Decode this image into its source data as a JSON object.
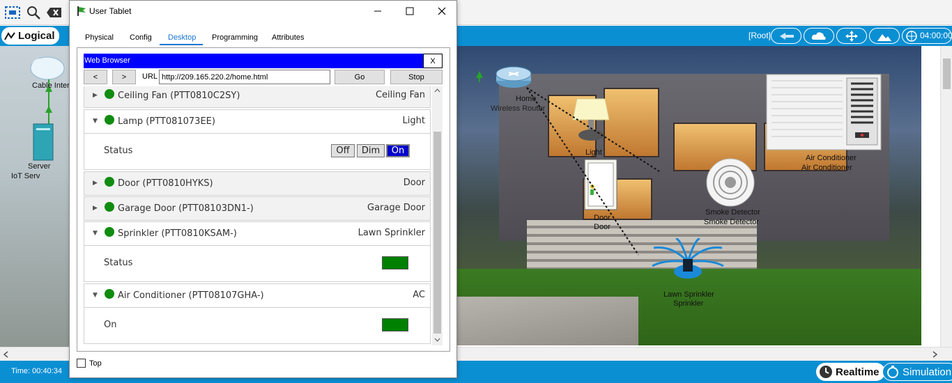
{
  "window": {
    "title": "User Tablet"
  },
  "tabs": [
    "Physical",
    "Config",
    "Desktop",
    "Programming",
    "Attributes"
  ],
  "active_tab": "Desktop",
  "browser": {
    "title": "Web Browser",
    "close_label": "X",
    "back_label": "<",
    "forward_label": ">",
    "url_label": "URL",
    "url_value": "http://209.165.220.2/home.html",
    "go_label": "Go",
    "stop_label": "Stop"
  },
  "devices": [
    {
      "name": "Ceiling Fan (PTT0810C2SY)",
      "type": "Ceiling Fan",
      "expanded": false
    },
    {
      "name": "Lamp (PTT081073EE)",
      "type": "Light",
      "expanded": true,
      "body_label": "Status",
      "buttons": [
        "Off",
        "Dim",
        "On"
      ],
      "active_button": "On"
    },
    {
      "name": "Door (PTT0810HYKS)",
      "type": "Door",
      "expanded": false
    },
    {
      "name": "Garage Door (PTT08103DN1-)",
      "type": "Garage Door",
      "expanded": false
    },
    {
      "name": "Sprinkler (PTT0810KSAM-)",
      "type": "Lawn Sprinkler",
      "expanded": true,
      "body_label": "Status",
      "indicator_color": "#008000"
    },
    {
      "name": "Air Conditioner (PTT08107GHA-)",
      "type": "AC",
      "expanded": true,
      "body_label": "On",
      "indicator_color": "#008000"
    }
  ],
  "top_checkbox": {
    "label": "Top",
    "checked": false
  },
  "toolbar": {
    "logical_label": "Logical",
    "root_label": "[Root]",
    "clock": "04:00:00"
  },
  "left_workspace": {
    "cloud_label": "Cable Inter",
    "server_label_1": "Server",
    "server_label_2": "IoT Serv"
  },
  "scene_labels": {
    "router_top": "Home",
    "router": "Wireless Router",
    "light": "Light",
    "door_1": "Door",
    "door_2": "Door",
    "smoke_1": "Smoke Detector",
    "smoke_2": "Smoke Detector",
    "ac_1": "Air Conditioner",
    "ac_2": "Air Conditioner",
    "sprinkler_1": "Lawn Sprinkler",
    "sprinkler_2": "Sprinkler"
  },
  "status_bar": {
    "time": "Time: 00:40:34",
    "realtime_label": "Realtime",
    "simulation_label": "Simulation"
  },
  "colors": {
    "accent_blue": "#0b8fd3",
    "browser_title": "#0000ff",
    "status_green": "#108c10",
    "active_button": "#0000cc"
  }
}
